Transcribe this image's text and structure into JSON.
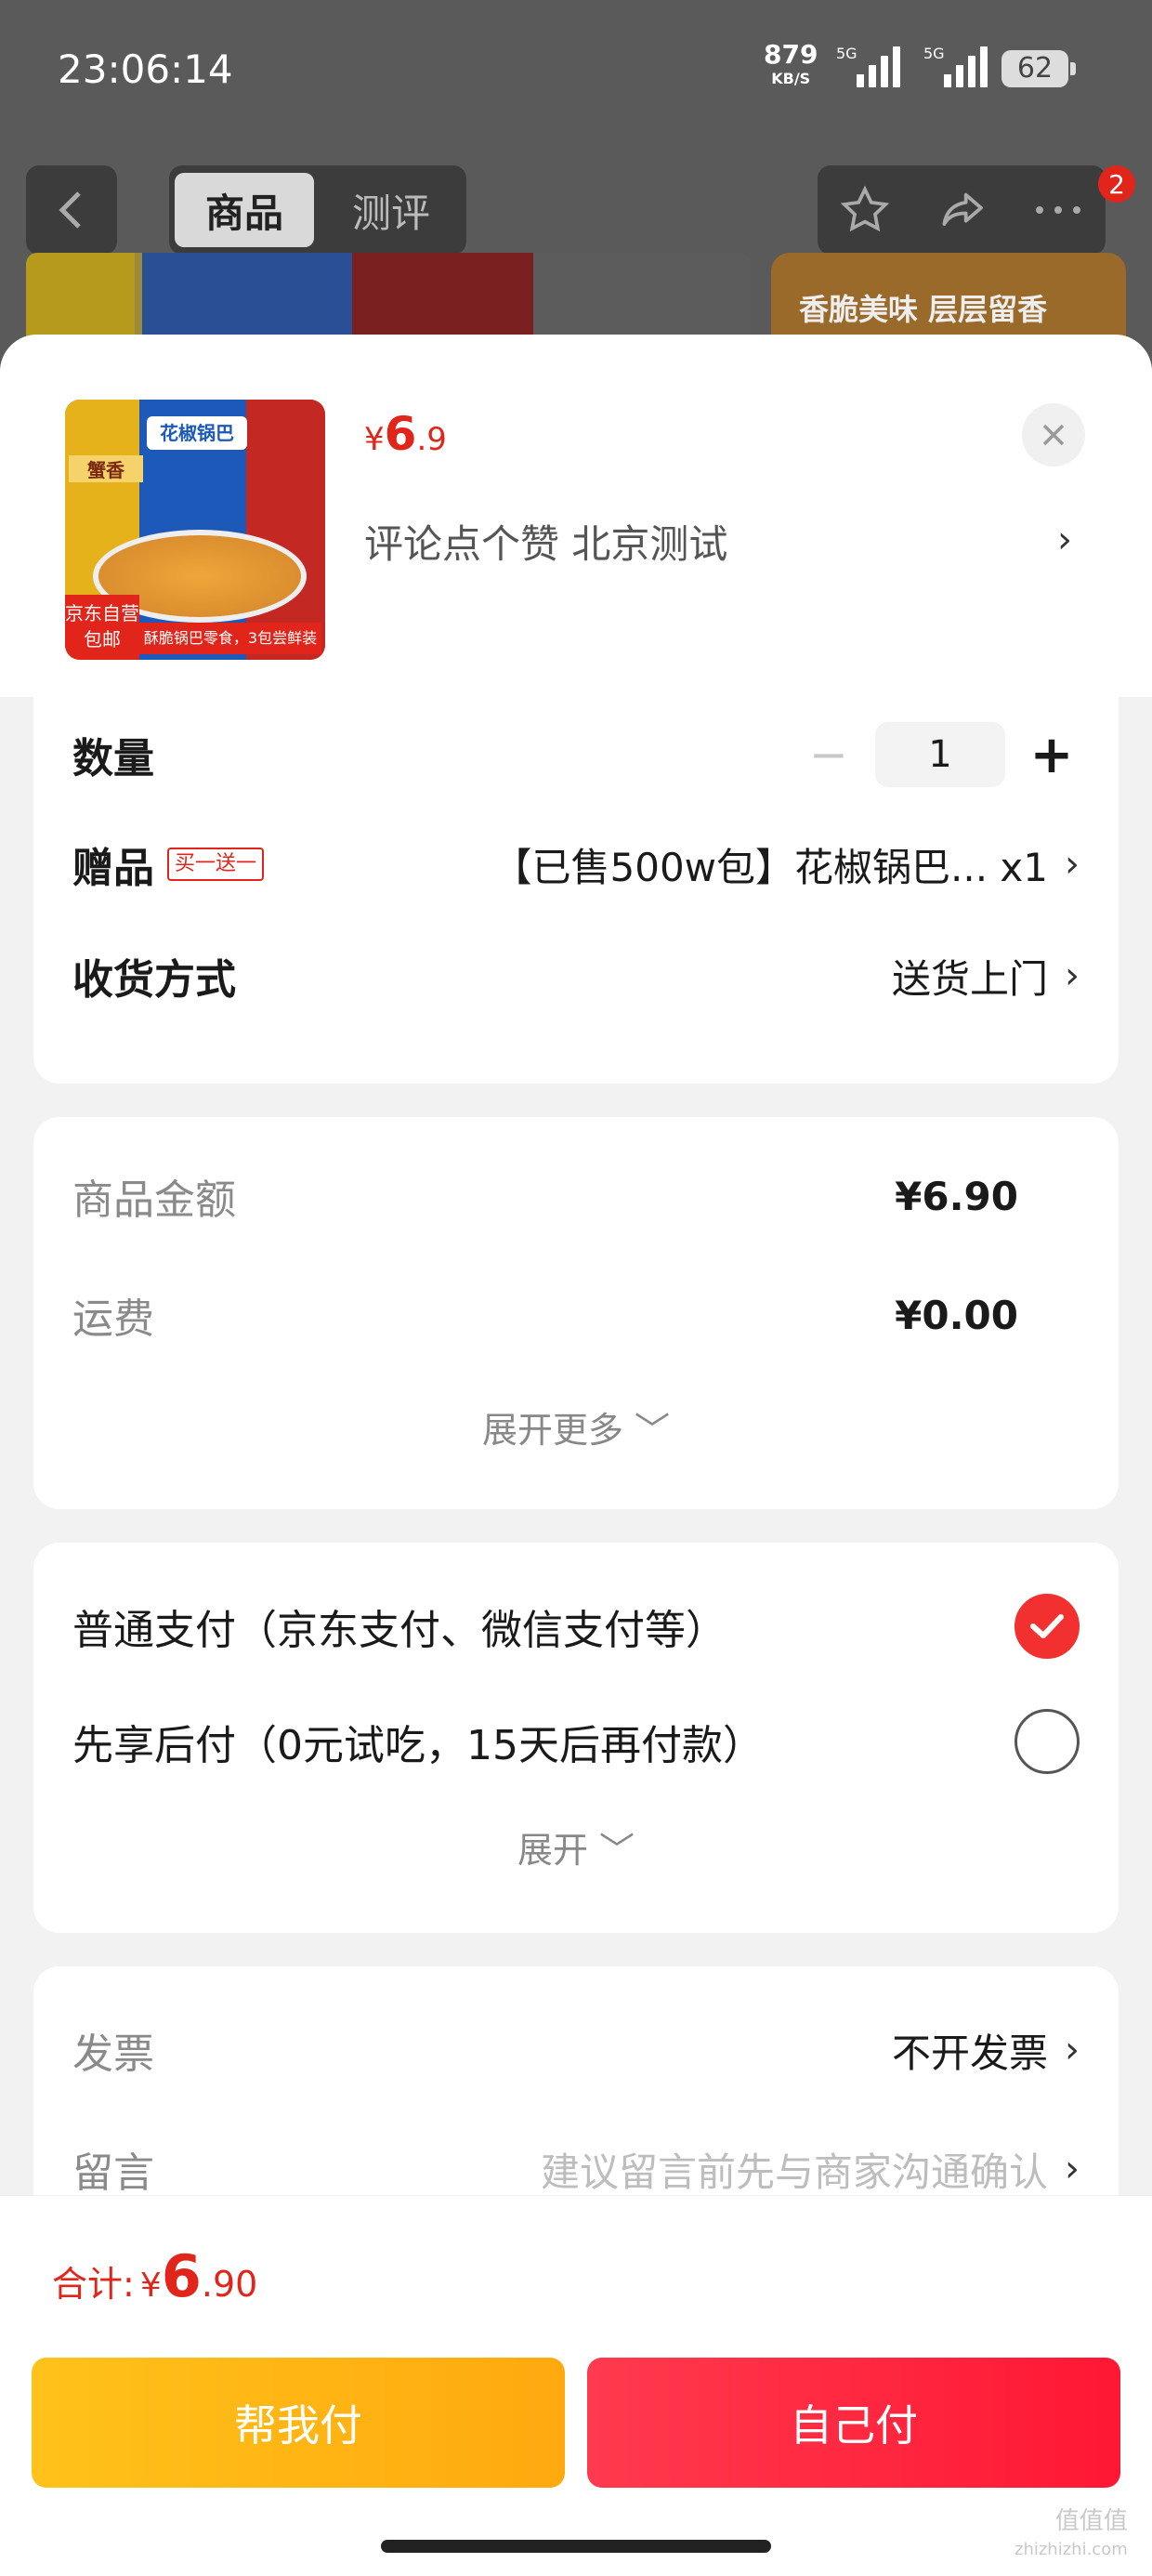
{
  "status_bar": {
    "time": "23:06:14",
    "net_speed": "879",
    "net_unit": "KB/S",
    "signal1": "5G",
    "signal2": "5G",
    "battery": "62"
  },
  "nav": {
    "tabs": [
      "商品",
      "测评"
    ],
    "active_tab": "商品",
    "badge_count": "2"
  },
  "background": {
    "banner_text": "香脆美味 层层留香"
  },
  "product": {
    "price_symbol": "¥",
    "price_int": "6",
    "price_dec": ".9",
    "spec_text": "评论点个赞  北京测试",
    "thumb": {
      "title": "花椒锅巴",
      "left_label": "蟹香",
      "badge_top": "京东自营",
      "badge_bottom": "包邮",
      "footer": "酥脆锅巴零食，3包尝鲜装"
    }
  },
  "options": {
    "quantity_label": "数量",
    "quantity_value": "1",
    "gift_label": "赠品",
    "gift_tag": "买一送一",
    "gift_value": "【已售500w包】花椒锅巴... x1",
    "delivery_label": "收货方式",
    "delivery_value": "送货上门"
  },
  "amounts": {
    "goods_label": "商品金额",
    "goods_value": "¥6.90",
    "shipping_label": "运费",
    "shipping_value": "¥0.00",
    "expand_more": "展开更多"
  },
  "payment": {
    "option1": "普通支付（京东支付、微信支付等）",
    "option2": "先享后付（0元试吃，15天后再付款）",
    "selected": "option1",
    "expand": "展开"
  },
  "extras": {
    "invoice_label": "发票",
    "invoice_value": "不开发票",
    "message_label": "留言",
    "message_placeholder": "建议留言前先与商家沟通确认"
  },
  "footer": {
    "total_label": "合计:",
    "total_symbol": "¥",
    "total_int": "6",
    "total_dec": ".90",
    "btn_help": "帮我付",
    "btn_self": "自己付",
    "watermark": "值值值",
    "watermark_url": "zhizhizhi.com"
  },
  "colors": {
    "accent": "#e1251b",
    "pay_self": "#ff1734",
    "pay_help": "#ffb414"
  }
}
